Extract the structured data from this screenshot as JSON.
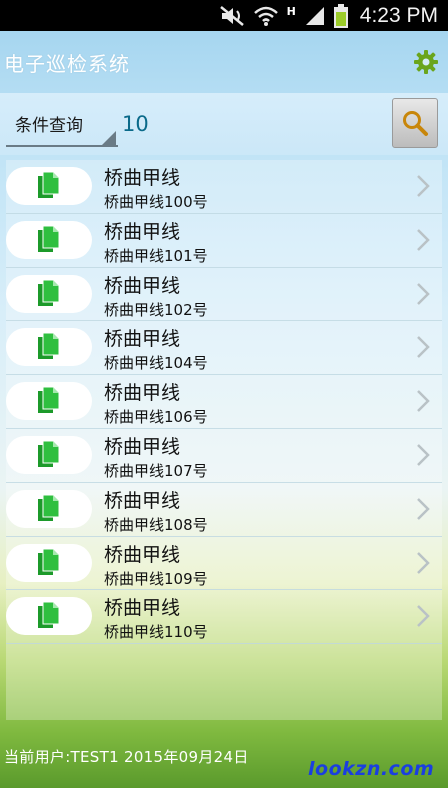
{
  "status_bar": {
    "time": "4:23 PM",
    "network_label": "H",
    "icons": [
      "mute-icon",
      "wifi-icon",
      "signal-icon",
      "battery-icon"
    ]
  },
  "app": {
    "title": "电子巡检系统",
    "settings_icon": "gear-icon",
    "accent": "#6aa51c"
  },
  "search": {
    "condition_label": "条件查询",
    "value": "10",
    "button_icon": "search-icon"
  },
  "items": [
    {
      "title": "桥曲甲线",
      "subtitle": "桥曲甲线100号"
    },
    {
      "title": "桥曲甲线",
      "subtitle": "桥曲甲线101号"
    },
    {
      "title": "桥曲甲线",
      "subtitle": "桥曲甲线102号"
    },
    {
      "title": "桥曲甲线",
      "subtitle": "桥曲甲线104号"
    },
    {
      "title": "桥曲甲线",
      "subtitle": "桥曲甲线106号"
    },
    {
      "title": "桥曲甲线",
      "subtitle": "桥曲甲线107号"
    },
    {
      "title": "桥曲甲线",
      "subtitle": "桥曲甲线108号"
    },
    {
      "title": "桥曲甲线",
      "subtitle": "桥曲甲线109号"
    },
    {
      "title": "桥曲甲线",
      "subtitle": "桥曲甲线110号"
    }
  ],
  "item_icon": "document-icon",
  "item_icon_color": "#1c9a2a",
  "footer": {
    "text": "当前用户:TEST1   2015年09月24日"
  },
  "watermark": "lookzn.com"
}
